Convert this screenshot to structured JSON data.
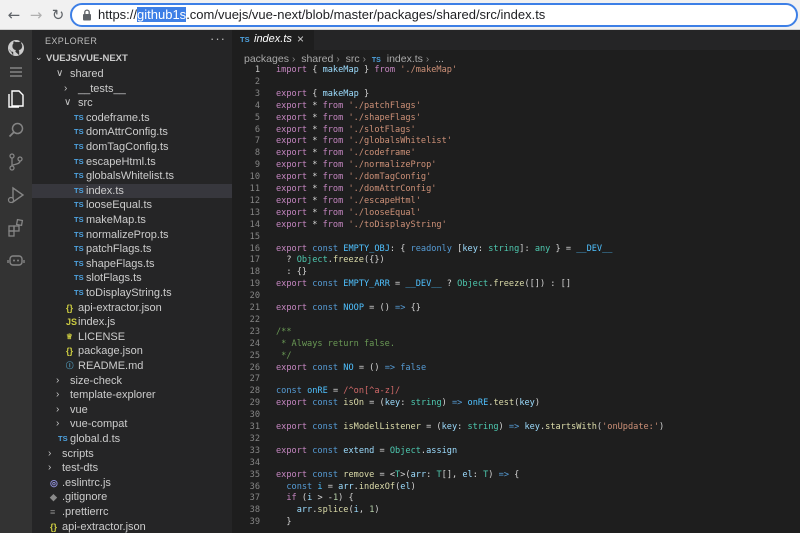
{
  "browser": {
    "url_selected": "github1s",
    "url_rest": ".com/vuejs/vue-next/blob/master/packages/shared/src/index.ts",
    "url_prefix": "https://"
  },
  "activity_bar": {
    "icons": [
      "github-icon",
      "menu-icon",
      "files-icon",
      "search-icon",
      "source-control-icon",
      "run-debug-icon",
      "extensions-icon",
      "copilot-icon"
    ]
  },
  "sidebar": {
    "title": "EXPLORER",
    "more": "···",
    "root": "VUEJS/VUE-NEXT",
    "tree": [
      {
        "label": "shared",
        "kind": "folder-open",
        "depth": 1
      },
      {
        "label": "__tests__",
        "kind": "folder",
        "depth": 2
      },
      {
        "label": "src",
        "kind": "folder-open",
        "depth": 2
      },
      {
        "label": "codeframe.ts",
        "kind": "ts",
        "depth": 3
      },
      {
        "label": "domAttrConfig.ts",
        "kind": "ts",
        "depth": 3
      },
      {
        "label": "domTagConfig.ts",
        "kind": "ts",
        "depth": 3
      },
      {
        "label": "escapeHtml.ts",
        "kind": "ts",
        "depth": 3
      },
      {
        "label": "globalsWhitelist.ts",
        "kind": "ts",
        "depth": 3
      },
      {
        "label": "index.ts",
        "kind": "ts",
        "depth": 3,
        "active": true
      },
      {
        "label": "looseEqual.ts",
        "kind": "ts",
        "depth": 3
      },
      {
        "label": "makeMap.ts",
        "kind": "ts",
        "depth": 3
      },
      {
        "label": "normalizeProp.ts",
        "kind": "ts",
        "depth": 3
      },
      {
        "label": "patchFlags.ts",
        "kind": "ts",
        "depth": 3
      },
      {
        "label": "shapeFlags.ts",
        "kind": "ts",
        "depth": 3
      },
      {
        "label": "slotFlags.ts",
        "kind": "ts",
        "depth": 3
      },
      {
        "label": "toDisplayString.ts",
        "kind": "ts",
        "depth": 3
      },
      {
        "label": "api-extractor.json",
        "kind": "json",
        "depth": 2
      },
      {
        "label": "index.js",
        "kind": "js",
        "depth": 2
      },
      {
        "label": "LICENSE",
        "kind": "lic",
        "depth": 2
      },
      {
        "label": "package.json",
        "kind": "json",
        "depth": 2
      },
      {
        "label": "README.md",
        "kind": "md",
        "depth": 2
      },
      {
        "label": "size-check",
        "kind": "folder",
        "depth": 1
      },
      {
        "label": "template-explorer",
        "kind": "folder",
        "depth": 1
      },
      {
        "label": "vue",
        "kind": "folder",
        "depth": 1
      },
      {
        "label": "vue-compat",
        "kind": "folder",
        "depth": 1
      },
      {
        "label": "global.d.ts",
        "kind": "ts",
        "depth": 1
      },
      {
        "label": "scripts",
        "kind": "folder",
        "depth": 0
      },
      {
        "label": "test-dts",
        "kind": "folder",
        "depth": 0
      },
      {
        "label": ".eslintrc.js",
        "kind": "rc",
        "depth": 0
      },
      {
        "label": ".gitignore",
        "kind": "git",
        "depth": 0
      },
      {
        "label": ".prettierrc",
        "kind": "pret",
        "depth": 0
      },
      {
        "label": "api-extractor.json",
        "kind": "json",
        "depth": 0
      }
    ]
  },
  "editor": {
    "tab_label": "index.ts",
    "tab_icon": "TS",
    "tab_close": "×",
    "breadcrumbs": [
      "packages",
      "shared",
      "src",
      "index.ts",
      "..."
    ],
    "lines": [
      [
        [
          "kw2",
          "import"
        ],
        [
          "op",
          " { "
        ],
        [
          "id",
          "makeMap"
        ],
        [
          "op",
          " } "
        ],
        [
          "kw2",
          "from"
        ],
        [
          "op",
          " "
        ],
        [
          "str",
          "'./makeMap'"
        ]
      ],
      [],
      [
        [
          "kw2",
          "export"
        ],
        [
          "op",
          " { "
        ],
        [
          "id",
          "makeMap"
        ],
        [
          "op",
          " }"
        ]
      ],
      [
        [
          "kw2",
          "export"
        ],
        [
          "op",
          " * "
        ],
        [
          "kw2",
          "from"
        ],
        [
          "op",
          " "
        ],
        [
          "str",
          "'./patchFlags'"
        ]
      ],
      [
        [
          "kw2",
          "export"
        ],
        [
          "op",
          " * "
        ],
        [
          "kw2",
          "from"
        ],
        [
          "op",
          " "
        ],
        [
          "str",
          "'./shapeFlags'"
        ]
      ],
      [
        [
          "kw2",
          "export"
        ],
        [
          "op",
          " * "
        ],
        [
          "kw2",
          "from"
        ],
        [
          "op",
          " "
        ],
        [
          "str",
          "'./slotFlags'"
        ]
      ],
      [
        [
          "kw2",
          "export"
        ],
        [
          "op",
          " * "
        ],
        [
          "kw2",
          "from"
        ],
        [
          "op",
          " "
        ],
        [
          "str",
          "'./globalsWhitelist'"
        ]
      ],
      [
        [
          "kw2",
          "export"
        ],
        [
          "op",
          " * "
        ],
        [
          "kw2",
          "from"
        ],
        [
          "op",
          " "
        ],
        [
          "str",
          "'./codeframe'"
        ]
      ],
      [
        [
          "kw2",
          "export"
        ],
        [
          "op",
          " * "
        ],
        [
          "kw2",
          "from"
        ],
        [
          "op",
          " "
        ],
        [
          "str",
          "'./normalizeProp'"
        ]
      ],
      [
        [
          "kw2",
          "export"
        ],
        [
          "op",
          " * "
        ],
        [
          "kw2",
          "from"
        ],
        [
          "op",
          " "
        ],
        [
          "str",
          "'./domTagConfig'"
        ]
      ],
      [
        [
          "kw2",
          "export"
        ],
        [
          "op",
          " * "
        ],
        [
          "kw2",
          "from"
        ],
        [
          "op",
          " "
        ],
        [
          "str",
          "'./domAttrConfig'"
        ]
      ],
      [
        [
          "kw2",
          "export"
        ],
        [
          "op",
          " * "
        ],
        [
          "kw2",
          "from"
        ],
        [
          "op",
          " "
        ],
        [
          "str",
          "'./escapeHtml'"
        ]
      ],
      [
        [
          "kw2",
          "export"
        ],
        [
          "op",
          " * "
        ],
        [
          "kw2",
          "from"
        ],
        [
          "op",
          " "
        ],
        [
          "str",
          "'./looseEqual'"
        ]
      ],
      [
        [
          "kw2",
          "export"
        ],
        [
          "op",
          " * "
        ],
        [
          "kw2",
          "from"
        ],
        [
          "op",
          " "
        ],
        [
          "str",
          "'./toDisplayString'"
        ]
      ],
      [],
      [
        [
          "kw2",
          "export"
        ],
        [
          "op",
          " "
        ],
        [
          "kw",
          "const"
        ],
        [
          "op",
          " "
        ],
        [
          "cst",
          "EMPTY_OBJ"
        ],
        [
          "op",
          ": { "
        ],
        [
          "kw",
          "readonly"
        ],
        [
          "op",
          " ["
        ],
        [
          "id",
          "key"
        ],
        [
          "op",
          ": "
        ],
        [
          "ty",
          "string"
        ],
        [
          "op",
          "]: "
        ],
        [
          "ty",
          "any"
        ],
        [
          "op",
          " } = "
        ],
        [
          "cst",
          "__DEV__"
        ]
      ],
      [
        [
          "op",
          "  ? "
        ],
        [
          "ty",
          "Object"
        ],
        [
          "op",
          "."
        ],
        [
          "fn",
          "freeze"
        ],
        [
          "op",
          "({})"
        ]
      ],
      [
        [
          "op",
          "  : {}"
        ]
      ],
      [
        [
          "kw2",
          "export"
        ],
        [
          "op",
          " "
        ],
        [
          "kw",
          "const"
        ],
        [
          "op",
          " "
        ],
        [
          "cst",
          "EMPTY_ARR"
        ],
        [
          "op",
          " = "
        ],
        [
          "cst",
          "__DEV__"
        ],
        [
          "op",
          " ? "
        ],
        [
          "ty",
          "Object"
        ],
        [
          "op",
          "."
        ],
        [
          "fn",
          "freeze"
        ],
        [
          "op",
          "([]) : []"
        ]
      ],
      [],
      [
        [
          "kw2",
          "export"
        ],
        [
          "op",
          " "
        ],
        [
          "kw",
          "const"
        ],
        [
          "op",
          " "
        ],
        [
          "cst",
          "NOOP"
        ],
        [
          "op",
          " = () "
        ],
        [
          "kw",
          "=>"
        ],
        [
          "op",
          " {}"
        ]
      ],
      [],
      [
        [
          "cm",
          "/**"
        ]
      ],
      [
        [
          "cm",
          " * Always return false."
        ]
      ],
      [
        [
          "cm",
          " */"
        ]
      ],
      [
        [
          "kw2",
          "export"
        ],
        [
          "op",
          " "
        ],
        [
          "kw",
          "const"
        ],
        [
          "op",
          " "
        ],
        [
          "cst",
          "NO"
        ],
        [
          "op",
          " = () "
        ],
        [
          "kw",
          "=>"
        ],
        [
          "op",
          " "
        ],
        [
          "kw",
          "false"
        ]
      ],
      [],
      [
        [
          "kw",
          "const"
        ],
        [
          "op",
          " "
        ],
        [
          "cst",
          "onRE"
        ],
        [
          "op",
          " = "
        ],
        [
          "rx",
          "/^on[^a-z]/"
        ]
      ],
      [
        [
          "kw2",
          "export"
        ],
        [
          "op",
          " "
        ],
        [
          "kw",
          "const"
        ],
        [
          "op",
          " "
        ],
        [
          "fn",
          "isOn"
        ],
        [
          "op",
          " = ("
        ],
        [
          "id",
          "key"
        ],
        [
          "op",
          ": "
        ],
        [
          "ty",
          "string"
        ],
        [
          "op",
          ") "
        ],
        [
          "kw",
          "=>"
        ],
        [
          "op",
          " "
        ],
        [
          "cst",
          "onRE"
        ],
        [
          "op",
          "."
        ],
        [
          "fn",
          "test"
        ],
        [
          "op",
          "("
        ],
        [
          "id",
          "key"
        ],
        [
          "op",
          ")"
        ]
      ],
      [],
      [
        [
          "kw2",
          "export"
        ],
        [
          "op",
          " "
        ],
        [
          "kw",
          "const"
        ],
        [
          "op",
          " "
        ],
        [
          "fn",
          "isModelListener"
        ],
        [
          "op",
          " = ("
        ],
        [
          "id",
          "key"
        ],
        [
          "op",
          ": "
        ],
        [
          "ty",
          "string"
        ],
        [
          "op",
          ") "
        ],
        [
          "kw",
          "=>"
        ],
        [
          "op",
          " "
        ],
        [
          "id",
          "key"
        ],
        [
          "op",
          "."
        ],
        [
          "fn",
          "startsWith"
        ],
        [
          "op",
          "("
        ],
        [
          "str",
          "'onUpdate:'"
        ],
        [
          "op",
          ")"
        ]
      ],
      [],
      [
        [
          "kw2",
          "export"
        ],
        [
          "op",
          " "
        ],
        [
          "kw",
          "const"
        ],
        [
          "op",
          " "
        ],
        [
          "id",
          "extend"
        ],
        [
          "op",
          " = "
        ],
        [
          "ty",
          "Object"
        ],
        [
          "op",
          "."
        ],
        [
          "id",
          "assign"
        ]
      ],
      [],
      [
        [
          "kw2",
          "export"
        ],
        [
          "op",
          " "
        ],
        [
          "kw",
          "const"
        ],
        [
          "op",
          " "
        ],
        [
          "fn",
          "remove"
        ],
        [
          "op",
          " = <"
        ],
        [
          "ty",
          "T"
        ],
        [
          "op",
          ">("
        ],
        [
          "id",
          "arr"
        ],
        [
          "op",
          ": "
        ],
        [
          "ty",
          "T"
        ],
        [
          "op",
          "[], "
        ],
        [
          "id",
          "el"
        ],
        [
          "op",
          ": "
        ],
        [
          "ty",
          "T"
        ],
        [
          "op",
          ") "
        ],
        [
          "kw",
          "=>"
        ],
        [
          "op",
          " {"
        ]
      ],
      [
        [
          "op",
          "  "
        ],
        [
          "kw",
          "const"
        ],
        [
          "op",
          " "
        ],
        [
          "cst",
          "i"
        ],
        [
          "op",
          " = "
        ],
        [
          "id",
          "arr"
        ],
        [
          "op",
          "."
        ],
        [
          "fn",
          "indexOf"
        ],
        [
          "op",
          "("
        ],
        [
          "id",
          "el"
        ],
        [
          "op",
          ")"
        ]
      ],
      [
        [
          "op",
          "  "
        ],
        [
          "kw2",
          "if"
        ],
        [
          "op",
          " ("
        ],
        [
          "id",
          "i"
        ],
        [
          "op",
          " > -"
        ],
        [
          "num",
          "1"
        ],
        [
          "op",
          ") {"
        ]
      ],
      [
        [
          "op",
          "    "
        ],
        [
          "id",
          "arr"
        ],
        [
          "op",
          "."
        ],
        [
          "fn",
          "splice"
        ],
        [
          "op",
          "("
        ],
        [
          "id",
          "i"
        ],
        [
          "op",
          ", "
        ],
        [
          "num",
          "1"
        ],
        [
          "op",
          ")"
        ]
      ],
      [
        [
          "op",
          "  }"
        ]
      ]
    ]
  }
}
